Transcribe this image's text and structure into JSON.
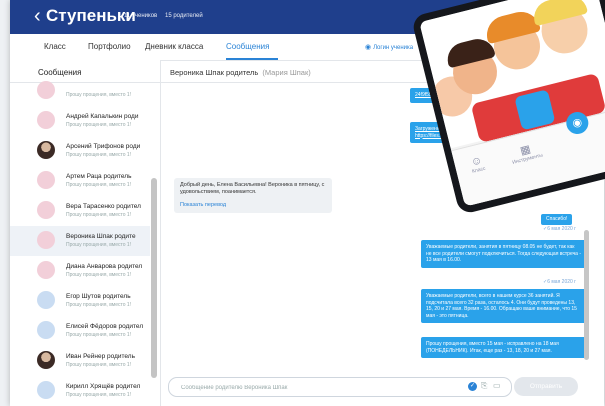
{
  "header": {
    "title": "Ступеньки",
    "back_icon": "chevron-left-icon",
    "students": "11 учеников",
    "parents": "15 родителей"
  },
  "tabs": [
    {
      "label": "Класс",
      "active": false
    },
    {
      "label": "Портфолио",
      "active": false
    },
    {
      "label": "Дневник класса",
      "active": false
    },
    {
      "label": "Сообщения",
      "active": true
    }
  ],
  "login_link": {
    "label": "Логин ученика",
    "icon": "eye-icon"
  },
  "sidebar": {
    "title": "Сообщения",
    "contacts": [
      {
        "name": "",
        "preview": "Прошу прощения, вместо 1!",
        "avatar": "pink"
      },
      {
        "name": "Андрей Капалькин роди",
        "preview": "Прошу прощения, вместо 1!",
        "avatar": "pink"
      },
      {
        "name": "Арсений Трифонов роди",
        "preview": "Прошу прощения, вместо 1!",
        "avatar": "photo"
      },
      {
        "name": "Артем Раца родитель",
        "preview": "Прошу прощения, вместо 1!",
        "avatar": "pink"
      },
      {
        "name": "Вера Тарасенко родител",
        "preview": "Прошу прощения, вместо 1!",
        "avatar": "pink"
      },
      {
        "name": "Вероника Шпак родите",
        "preview": "Прошу прощения, вместо 1!",
        "avatar": "pink",
        "selected": true
      },
      {
        "name": "Диана Анварова родител",
        "preview": "Прошу прощения, вместо 1!",
        "avatar": "pink"
      },
      {
        "name": "Егор Шутов родитель",
        "preview": "Прошу прощения, вместо 1!",
        "avatar": "blue"
      },
      {
        "name": "Елисей Фёдоров родител",
        "preview": "Прошу прощения, вместо 1!",
        "avatar": "blue"
      },
      {
        "name": "Иван Рейнер родитель",
        "preview": "Прошу прощения, вместо 1!",
        "avatar": "photo"
      },
      {
        "name": "Кирилл Хрящёв родител",
        "preview": "Прошу прощения, вместо 1!",
        "avatar": "blue"
      }
    ]
  },
  "chat": {
    "name": "Вероника Шпак родитель",
    "subname": "(Мария Шпак)",
    "incoming": {
      "text": "Добрый день, Елена Васильевна! Вероника в пятницу, с удовольствием, поанимается.",
      "translate": "Показать перевод"
    },
    "outgoing": [
      {
        "text": "24f9f558rt82_xy55f6ve",
        "link": true
      },
      {
        "text": "Загруженный файл: https://files.classdojo.com/8607fbs2a6b4e24d3f953d43e5332_9ef40ca4c",
        "link": true
      },
      {
        "text": "Спасибо!"
      },
      {
        "text": "Уважаемые родители, занятия в пятницу 08.05 не будет, так как не все родители смогут подключиться. Тогда следующая встреча - 13 мая в 16.00."
      },
      {
        "text": "Уважаемые родители, всего в нашем курсе 36 занятий. Я подсчитала всего 32 раза, осталось 4. Они будут проведены 13, 15, 20 и 27 мая. Время - 16.00. Обращаю ваше внимание, что 15 мая - это пятница."
      },
      {
        "text": "Прошу прощения, вместо 15 мая - исправлено на 18 мая (ПОНЕДЕЛЬНИК). Итак, еще раз - 13, 18, 20 и 27 мая."
      }
    ],
    "read_marks": [
      "✓6 мая 2020 г",
      "✓6 мая 2020 г"
    ]
  },
  "composer": {
    "placeholder": "Сообщение родителю Вероника Шпак",
    "send_label": "Отправить",
    "icons": [
      "checkmark-icon",
      "paperclip-icon",
      "file-icon"
    ]
  },
  "phone": {
    "nav": [
      {
        "label": "Класс",
        "icon": "class-icon"
      },
      {
        "label": "Инструменты",
        "icon": "tools-icon"
      }
    ],
    "camera_icon": "camera-icon"
  },
  "colors": {
    "topbar": "#1f3f8c",
    "accent": "#2a83d6",
    "bubble": "#2aa2ea"
  }
}
